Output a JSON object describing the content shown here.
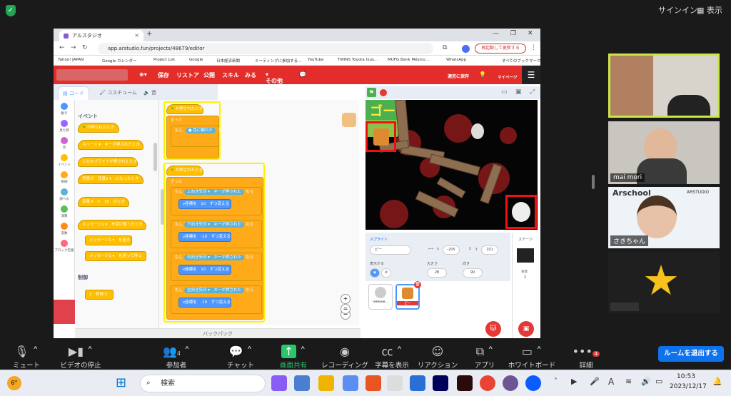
{
  "zoom_top": {
    "signin": "サインイン",
    "view": "表示"
  },
  "browser": {
    "tab_title": "アルスタジオ",
    "url": "app.arstudio.fun/projects/48679/editor",
    "reload_button": "再起動して更新する",
    "bookmarks": [
      "Yahoo! JAPAN",
      "Google カレンダー",
      "Project List",
      "Google",
      "日本経済新聞",
      "ミーティングに参加する…",
      "YouTube",
      "TWINS Toyota tsus…",
      "MUFG Bank México…",
      "WhatsApp",
      "すべてのブックマーク"
    ]
  },
  "app_menu": {
    "items": [
      "保存",
      "リストア",
      "公開",
      "スキル",
      "みる",
      "その他"
    ],
    "save_right": "適宜に保存",
    "mypage": "マイページ"
  },
  "editor_tabs": {
    "code": "コード",
    "costume": "コスチューム",
    "sound": "音"
  },
  "categories": [
    {
      "label": "動き",
      "color": "#4c97ff"
    },
    {
      "label": "見た目",
      "color": "#9966ff"
    },
    {
      "label": "音",
      "color": "#cf63cf"
    },
    {
      "label": "イベント",
      "color": "#ffbf00"
    },
    {
      "label": "制御",
      "color": "#ffab19"
    },
    {
      "label": "調べる",
      "color": "#5cb1d6"
    },
    {
      "label": "演算",
      "color": "#59c059"
    },
    {
      "label": "変数",
      "color": "#ff8c1a"
    },
    {
      "label": "ブロック定義",
      "color": "#ff6680"
    }
  ],
  "palette": {
    "section_event": "イベント",
    "blocks": [
      "が押されたとき",
      "スペース ▾　キーが押されたとき",
      "このスプライトが押されたとき",
      "背景が　背景1 ▾　になったとき",
      "音量 ▾　>　10　のとき",
      "メッセージ1 ▾　を受け取ったとき",
      "メッセージ1 ▾　を送る",
      "メッセージ1 ▾　を送って待つ"
    ],
    "section_control": "制御",
    "wait_block": "1　秒待つ"
  },
  "script1": {
    "hat": "が押されたとき",
    "forever": "ずっと",
    "if": "もし",
    "cond": "色に触れた",
    "then": "なら"
  },
  "script2": {
    "hat": "が押されたとき",
    "forever": "ずっと",
    "ifs": [
      {
        "key": "上向き矢印 ▾　キーが押された",
        "set": "y座標を　10　ずつ変える"
      },
      {
        "key": "下向き矢印 ▾　キーが押された",
        "set": "y座標を　-10　ずつ変える"
      },
      {
        "key": "右向き矢印 ▾　キーが押された",
        "set": "x座標を　10　ずつ変える"
      },
      {
        "key": "左向き矢印 ▾　キーが押された",
        "set": "x座標を　-10　ずつ変える"
      }
    ],
    "if_label": "もし",
    "then_label": "なら"
  },
  "backpack": "バックパック",
  "stage": {
    "goal_text": "ゴー"
  },
  "sprite_info": {
    "label_sprite": "スプライト",
    "name": "ピー",
    "x_label": "x",
    "x": "-205",
    "y_label": "y",
    "y": "101",
    "show_label": "表示する",
    "size_label": "大きさ",
    "size": "28",
    "dir_label": "向き",
    "direction": "90"
  },
  "sprite_list": [
    {
      "name": "remove..."
    },
    {
      "name": "ピー"
    }
  ],
  "stage_panel": {
    "title": "ステージ",
    "bg_label": "背景",
    "bg_count": "2"
  },
  "participants": [
    {
      "name": ""
    },
    {
      "name": "mai mori"
    },
    {
      "name": "さきちゃん",
      "school": "Arschool",
      "brand": "ARSTUDIO"
    },
    {
      "name": ""
    }
  ],
  "zoom_controls": {
    "mute": "ミュート",
    "video": "ビデオの停止",
    "participants": "参加者",
    "participant_count": "4",
    "chat": "チャット",
    "share": "画面共有",
    "record": "レコーディング",
    "captions": "字幕を表示",
    "reactions": "リアクション",
    "apps": "アプリ",
    "whiteboard": "ホワイトボード",
    "more": "詳細",
    "more_badge": "4",
    "leave": "ルームを退出する"
  },
  "taskbar": {
    "weather": "6°",
    "search": "検索",
    "time": "10:53",
    "date": "2023/12/17"
  }
}
